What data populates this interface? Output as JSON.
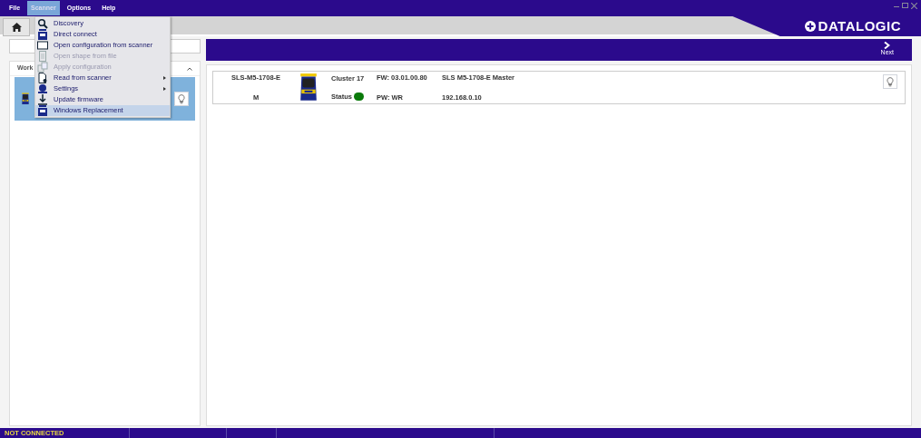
{
  "menubar": [
    {
      "label": "File",
      "selected": false
    },
    {
      "label": "Scanner",
      "selected": true
    },
    {
      "label": "Options",
      "selected": false
    },
    {
      "label": "Help",
      "selected": false
    }
  ],
  "logo": "DATALOGIC",
  "scanner_menu": [
    {
      "label": "Discovery",
      "disabled": false,
      "submenu": false,
      "selected": false
    },
    {
      "label": "Direct connect",
      "disabled": false,
      "submenu": false,
      "selected": false
    },
    {
      "label": "Open configuration from scanner",
      "disabled": false,
      "submenu": false,
      "selected": false
    },
    {
      "label": "Open shape from file",
      "disabled": true,
      "submenu": false,
      "selected": false
    },
    {
      "label": "Apply configuration",
      "disabled": true,
      "submenu": false,
      "selected": false
    },
    {
      "label": "Read from scanner",
      "disabled": false,
      "submenu": true,
      "selected": false
    },
    {
      "label": "Settings",
      "disabled": false,
      "submenu": true,
      "selected": false
    },
    {
      "label": "Update firmware",
      "disabled": false,
      "submenu": false,
      "selected": false
    },
    {
      "label": "Windows Replacement",
      "disabled": false,
      "submenu": false,
      "selected": true
    }
  ],
  "work_panel": {
    "title": "Work",
    "expanded": true,
    "items": [
      {
        "selected": true
      }
    ]
  },
  "next_button": "Next",
  "device": {
    "model": "SLS-M5-1708-E",
    "role": "M",
    "cluster": "Cluster 17",
    "status": {
      "label": "Status",
      "color": "#0a7a0a"
    },
    "fw": "FW: 03.01.00.80",
    "pw": "PW: WR",
    "name": "SLS M5-1708-E Master",
    "ip": "192.168.0.10"
  },
  "status_bar": [
    "NOT CONNECTED"
  ]
}
